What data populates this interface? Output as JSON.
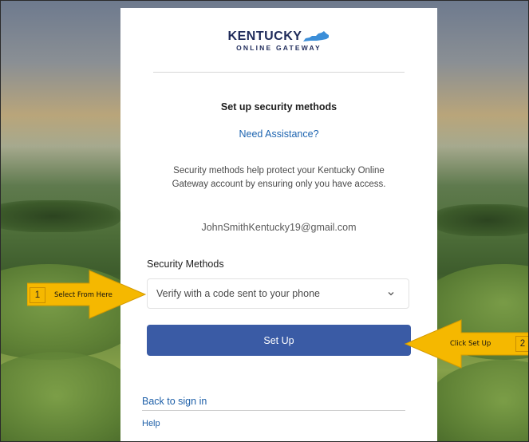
{
  "colors": {
    "primary_button": "#3a5ba5",
    "link": "#1d64b0",
    "logo": "#1f2b5a",
    "annotation": "#f5b800"
  },
  "logo": {
    "line1": "KENTUCKY",
    "line2": "ONLINE GATEWAY",
    "icon": "kentucky-state-shape-icon"
  },
  "page": {
    "title": "Set up security methods",
    "assist_link": "Need Assistance?",
    "description": "Security methods help protect your Kentucky Online Gateway account by ensuring only you have access.",
    "email": "JohnSmithKentucky19@gmail.com"
  },
  "form": {
    "methods_label": "Security Methods",
    "selected_method": "Verify with a code sent to your phone",
    "dropdown_icon": "chevron-down-icon",
    "setup_button": "Set Up"
  },
  "footer": {
    "back_link": "Back to sign in",
    "help_link": "Help"
  },
  "annotations": {
    "step1": {
      "number": "1",
      "text": "Select From Here"
    },
    "step2": {
      "number": "2",
      "text": "Click Set Up"
    }
  }
}
